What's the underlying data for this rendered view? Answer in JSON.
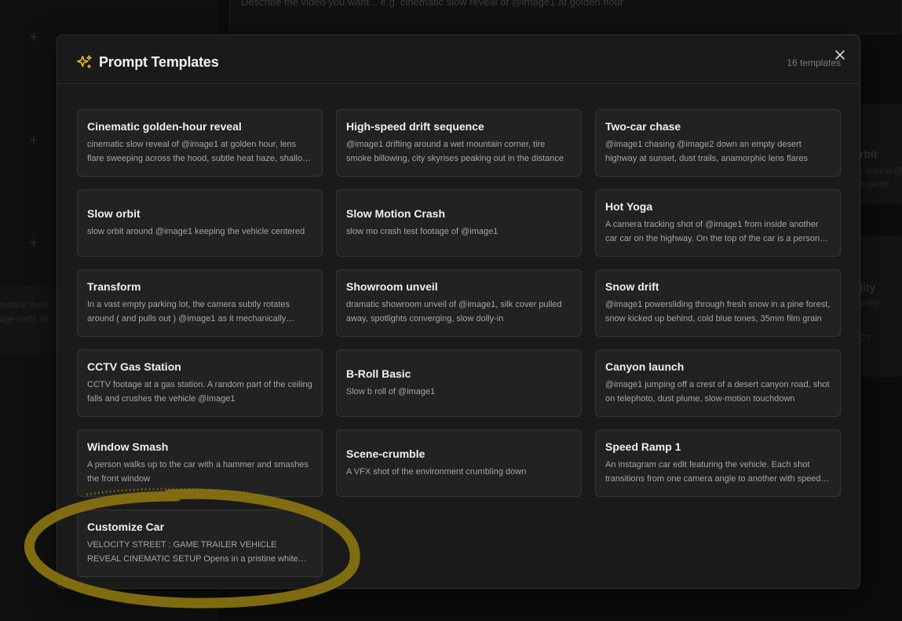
{
  "background": {
    "prompt_placeholder": "Describe the video you want... e.g. cinematic slow reveal of @image1 at golden hour",
    "sidebar_text_1": "terface them",
    "sidebar_text_2": "age shifts int",
    "right_title_1": "rbit",
    "right_sub_1a": "t around @",
    "right_sub_1b": "entered",
    "right_title_2": "lity",
    "right_sub_2a": "uality",
    "right_sub_2b": "CT"
  },
  "modal": {
    "title": "Prompt Templates",
    "count": "16 templates",
    "icon": "sparkles-icon",
    "accent_color": "#e6b422"
  },
  "templates": [
    {
      "title": "Cinematic golden-hour reveal",
      "description": "cinematic slow reveal of @image1 at golden hour, lens flare sweeping across the hood, subtle heat haze, shallow depth of field"
    },
    {
      "title": "High-speed drift sequence",
      "description": "@image1 drifting around a wet mountain corner, tire smoke billowing, city skyrises peaking out in the distance"
    },
    {
      "title": "Two-car chase",
      "description": "@image1 chasing @image2 down an empty desert highway at sunset, dust trails, anamorphic lens flares"
    },
    {
      "title": "Slow orbit",
      "description": "slow orbit around @image1 keeping the vehicle centered"
    },
    {
      "title": "Slow Motion Crash",
      "description": "slow mo crash test footage of @image1"
    },
    {
      "title": "Hot Yoga",
      "description": "A camera tracking shot of @image1 from inside another car car on the highway. On the top of the car is a person doing yoga"
    },
    {
      "title": "Transform",
      "description": "In a vast empty parking lot, the camera subtly rotates around ( and pulls out ) @image1 as it mechanically transforms"
    },
    {
      "title": "Showroom unveil",
      "description": "dramatic showroom unveil of @image1, silk cover pulled away, spotlights converging, slow dolly-in"
    },
    {
      "title": "Snow drift",
      "description": "@image1 powersliding through fresh snow in a pine forest, snow kicked up behind, cold blue tones, 35mm film grain"
    },
    {
      "title": "CCTV Gas Station",
      "description": "CCTV footage at a gas station. A random part of the ceiling falls and crushes the vehicle @image1"
    },
    {
      "title": "B-Roll Basic",
      "description": "Slow b roll of @image1"
    },
    {
      "title": "Canyon launch",
      "description": "@image1 jumping off a crest of a desert canyon road, shot on telephoto, dust plume, slow-motion touchdown"
    },
    {
      "title": "Window Smash",
      "description": "A person walks up to the car with a hammer and smashes the front window"
    },
    {
      "title": "Scene-crumble",
      "description": "A VFX shot of the environment crumbling down"
    },
    {
      "title": "Speed Ramp 1",
      "description": "An instagram car edit featuring the vehicle. Each shot transitions from one camera angle to another with speed ramps"
    },
    {
      "title": "Customize Car",
      "description": "VELOCITY STREET : GAME TRAILER VEHICLE REVEAL CINEMATIC SETUP Opens in a pristine white studio space"
    }
  ],
  "annotation": {
    "color": "#8a7410"
  }
}
